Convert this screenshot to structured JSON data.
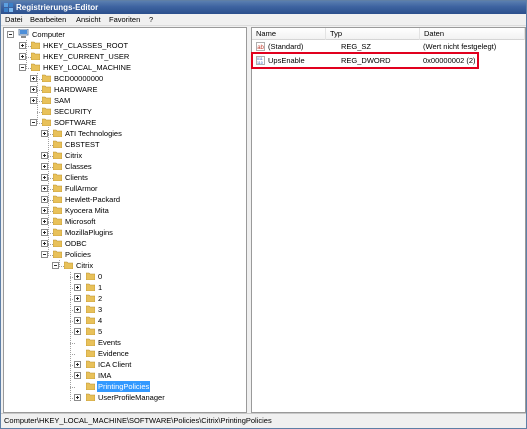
{
  "window": {
    "title": "Registrierungs-Editor"
  },
  "menu": [
    "Datei",
    "Bearbeiten",
    "Ansicht",
    "Favoriten",
    "?"
  ],
  "tree": {
    "root": "Computer",
    "hives": [
      "HKEY_CLASSES_ROOT",
      "HKEY_CURRENT_USER",
      "HKEY_LOCAL_MACHINE"
    ],
    "hklm_children": [
      "BCD00000000",
      "HARDWARE",
      "SAM",
      "SECURITY",
      "SOFTWARE"
    ],
    "software_children": [
      "ATI Technologies",
      "CBSTEST",
      "Citrix",
      "Classes",
      "Clients",
      "FullArmor",
      "Hewlett-Packard",
      "Kyocera Mita",
      "Microsoft",
      "MozillaPlugins",
      "ODBC",
      "Policies"
    ],
    "policies_children": [
      "Citrix"
    ],
    "citrix_children": [
      "0",
      "1",
      "2",
      "3",
      "4",
      "5",
      "Events",
      "Evidence",
      "ICA Client",
      "IMA",
      "PrintingPolicies",
      "UserProfileManager"
    ],
    "selected": "PrintingPolicies"
  },
  "list": {
    "columns": [
      "Name",
      "Typ",
      "Daten"
    ],
    "rows": [
      {
        "name": "(Standard)",
        "type": "REG_SZ",
        "data": "(Wert nicht festgelegt)"
      },
      {
        "name": "UpsEnable",
        "type": "REG_DWORD",
        "data": "0x00000002 (2)"
      }
    ]
  },
  "status": {
    "path": "Computer\\HKEY_LOCAL_MACHINE\\SOFTWARE\\Policies\\Citrix\\PrintingPolicies"
  },
  "colors": {
    "highlight_box": "#e1001e",
    "selection": "#3399ff",
    "folder": "#e8c15a"
  }
}
